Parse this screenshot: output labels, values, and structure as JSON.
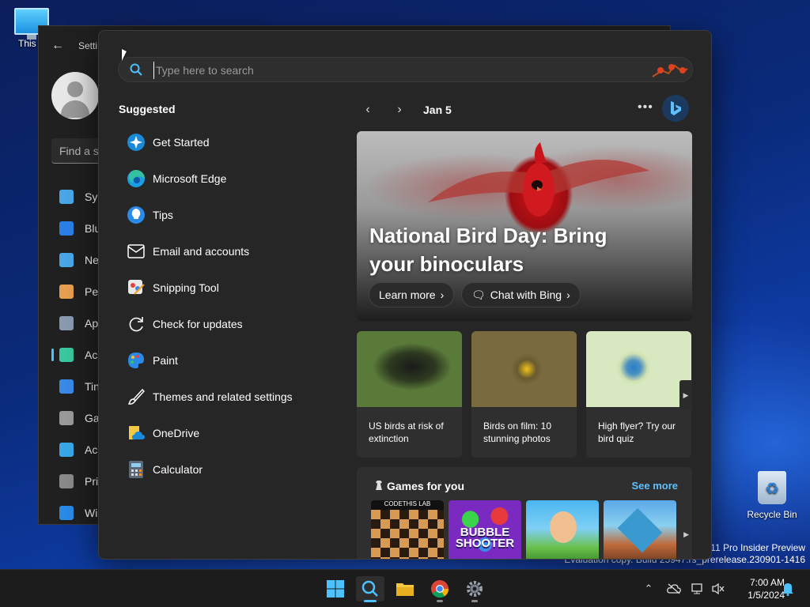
{
  "desktop": {
    "this_pc_label": "This P",
    "recycle_bin_label": "Recycle Bin",
    "watermark_line1": "s 11 Pro Insider Preview",
    "watermark_line2": "Evaluation copy. Build 25947.rs_prerelease.230901-1416"
  },
  "settings_window": {
    "title": "Setti",
    "find_placeholder": "Find a se",
    "nav": [
      {
        "label": "Sys",
        "icon": "system-icon",
        "color": "#4aa8e8"
      },
      {
        "label": "Blu",
        "icon": "bluetooth-icon",
        "color": "#2a7fe8"
      },
      {
        "label": "Ne",
        "icon": "wifi-icon",
        "color": "#4aa8e8"
      },
      {
        "label": "Per",
        "icon": "brush-icon",
        "color": "#e8a050"
      },
      {
        "label": "Ap",
        "icon": "apps-icon",
        "color": "#8a9ab0"
      },
      {
        "label": "Ac",
        "icon": "accounts-icon",
        "color": "#3ac8a0"
      },
      {
        "label": "Tin",
        "icon": "time-icon",
        "color": "#3a8ae8"
      },
      {
        "label": "Ga",
        "icon": "gaming-icon",
        "color": "#9a9a9a"
      },
      {
        "label": "Acc",
        "icon": "accessibility-icon",
        "color": "#3aa8e8"
      },
      {
        "label": "Pri",
        "icon": "shield-icon",
        "color": "#8a8a8a"
      },
      {
        "label": "Wi",
        "icon": "update-icon",
        "color": "#2a8ae8"
      }
    ]
  },
  "start": {
    "search_placeholder": "Type here to search",
    "suggested_title": "Suggested",
    "apps": [
      {
        "label": "Get Started",
        "icon": "get-started-icon"
      },
      {
        "label": "Microsoft Edge",
        "icon": "edge-icon"
      },
      {
        "label": "Tips",
        "icon": "tips-icon"
      },
      {
        "label": "Email and accounts",
        "icon": "mail-icon"
      },
      {
        "label": "Snipping Tool",
        "icon": "snipping-tool-icon"
      },
      {
        "label": "Check for updates",
        "icon": "refresh-icon"
      },
      {
        "label": "Paint",
        "icon": "paint-icon"
      },
      {
        "label": "Themes and related settings",
        "icon": "brush-icon"
      },
      {
        "label": "OneDrive",
        "icon": "onedrive-icon"
      },
      {
        "label": "Calculator",
        "icon": "calculator-icon"
      }
    ],
    "date": "Jan 5",
    "hero": {
      "headline": "National Bird Day: Bring your binoculars",
      "learn_more": "Learn more",
      "chat_with_bing": "Chat with Bing"
    },
    "cards": [
      {
        "text": "US birds at risk of extinction"
      },
      {
        "text": "Birds on film: 10 stunning photos"
      },
      {
        "text": "High flyer? Try our bird quiz"
      }
    ],
    "games": {
      "title": "Games for you",
      "see_more": "See more",
      "tiles": [
        {
          "label": "CODETHIS LAB"
        },
        {
          "label": "BUBBLE SHOOTER"
        },
        {
          "label": ""
        },
        {
          "label": ""
        }
      ]
    }
  },
  "taskbar": {
    "time": "7:00 AM",
    "date": "1/5/2024",
    "accent": "#4cc2ff"
  }
}
